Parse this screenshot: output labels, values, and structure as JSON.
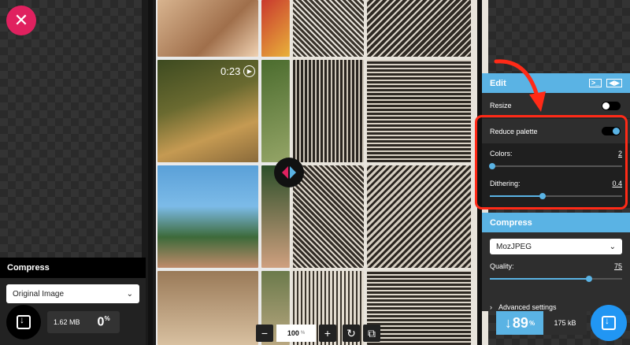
{
  "close": {
    "symbol": "✕"
  },
  "preview": {
    "video_time": "0:23",
    "zoom": {
      "minus": "−",
      "value": "100",
      "unit": "%",
      "plus": "+"
    }
  },
  "left_panel": {
    "title": "Compress",
    "format": "Original Image",
    "size": "1.62 MB",
    "pct": "0",
    "pct_unit": "%"
  },
  "right_panel": {
    "edit_title": "Edit",
    "resize_label": "Resize",
    "resize_on": false,
    "reduce_palette_label": "Reduce palette",
    "reduce_palette_on": true,
    "colors_label": "Colors:",
    "colors_value": "2",
    "colors_fraction": 0.02,
    "dithering_label": "Dithering:",
    "dithering_value": "0.4",
    "dithering_fraction": 0.4,
    "compress_title": "Compress",
    "codec": "MozJPEG",
    "quality_label": "Quality:",
    "quality_value": "75",
    "quality_fraction": 0.75,
    "advanced_label": "Advanced settings",
    "result_arrow": "↓",
    "result_pct": "89",
    "result_pct_unit": "%",
    "result_size": "175 kB"
  },
  "colors": {
    "accent": "#5ab3e4",
    "close": "#e0215f",
    "highlight": "#ff2a17"
  },
  "icons": [
    "close-icon",
    "play-icon",
    "split-handle-icon",
    "download-icon",
    "terminal-icon",
    "code-icon",
    "chevron-down-icon",
    "chevron-right-icon",
    "rotate-icon",
    "fit-icon"
  ]
}
